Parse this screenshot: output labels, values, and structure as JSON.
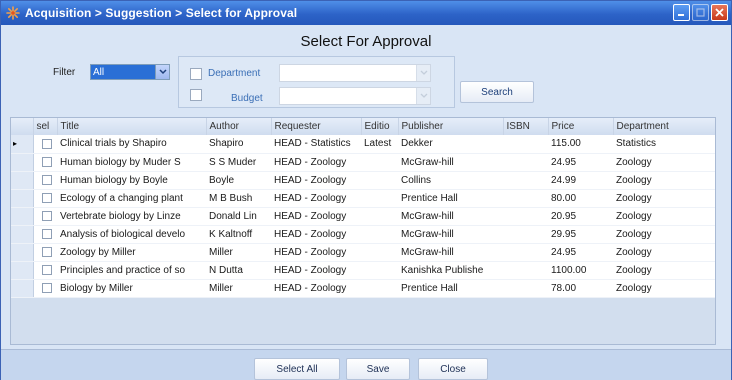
{
  "window": {
    "title": "Acquisition > Suggestion > Select for Approval"
  },
  "heading": "Select For Approval",
  "filter": {
    "label": "Filter",
    "selected": "All",
    "department_label": "Department",
    "budget_label": "Budget",
    "search_label": "Search"
  },
  "grid": {
    "columns": [
      "sel",
      "Title",
      "Author",
      "Requester",
      "Editio",
      "Publisher",
      "ISBN",
      "Price",
      "Department"
    ],
    "rows": [
      {
        "title": "Clinical trials by Shapiro",
        "author": "Shapiro",
        "requester": "HEAD - Statistics",
        "edition": "Latest",
        "publisher": "Dekker",
        "isbn": "",
        "price": "115.00",
        "department": "Statistics",
        "current": "▸"
      },
      {
        "title": "Human biology by Muder S",
        "author": "S S Muder",
        "requester": "HEAD - Zoology",
        "edition": "",
        "publisher": "McGraw-hill",
        "isbn": "",
        "price": "24.95",
        "department": "Zoology",
        "current": ""
      },
      {
        "title": "Human biology by Boyle",
        "author": "Boyle",
        "requester": "HEAD - Zoology",
        "edition": "",
        "publisher": "Collins",
        "isbn": "",
        "price": "24.99",
        "department": "Zoology",
        "current": ""
      },
      {
        "title": "Ecology of a changing plant",
        "author": "M B Bush",
        "requester": "HEAD - Zoology",
        "edition": "",
        "publisher": "Prentice Hall",
        "isbn": "",
        "price": "80.00",
        "department": "Zoology",
        "current": ""
      },
      {
        "title": "Vertebrate biology by Linze",
        "author": "Donald Lin",
        "requester": "HEAD - Zoology",
        "edition": "",
        "publisher": "McGraw-hill",
        "isbn": "",
        "price": "20.95",
        "department": "Zoology",
        "current": ""
      },
      {
        "title": "Analysis of biological develo",
        "author": "K Kaltnoff",
        "requester": "HEAD - Zoology",
        "edition": "",
        "publisher": "McGraw-hill",
        "isbn": "",
        "price": "29.95",
        "department": "Zoology",
        "current": ""
      },
      {
        "title": "Zoology by Miller",
        "author": "Miller",
        "requester": "HEAD - Zoology",
        "edition": "",
        "publisher": "McGraw-hill",
        "isbn": "",
        "price": "24.95",
        "department": "Zoology",
        "current": ""
      },
      {
        "title": "Principles and practice of so",
        "author": "N Dutta",
        "requester": "HEAD - Zoology",
        "edition": "",
        "publisher": "Kanishka Publishe",
        "isbn": "",
        "price": "1100.00",
        "department": "Zoology",
        "current": ""
      },
      {
        "title": "Biology by Miller",
        "author": "Miller",
        "requester": "HEAD - Zoology",
        "edition": "",
        "publisher": "Prentice Hall",
        "isbn": "",
        "price": "78.00",
        "department": "Zoology",
        "current": ""
      }
    ]
  },
  "buttons": {
    "select_all": "Select All",
    "save": "Save",
    "close": "Close"
  },
  "icons": {
    "app": "snowflake-app-icon",
    "minimize": "minimize-icon",
    "maximize": "maximize-icon",
    "close": "close-icon",
    "dropdown": "chevron-down-icon"
  },
  "colors": {
    "titlebar": "#2d63c8",
    "background": "#d9e5f5",
    "selection": "#2a6fd6",
    "close_button": "#c8391c"
  }
}
